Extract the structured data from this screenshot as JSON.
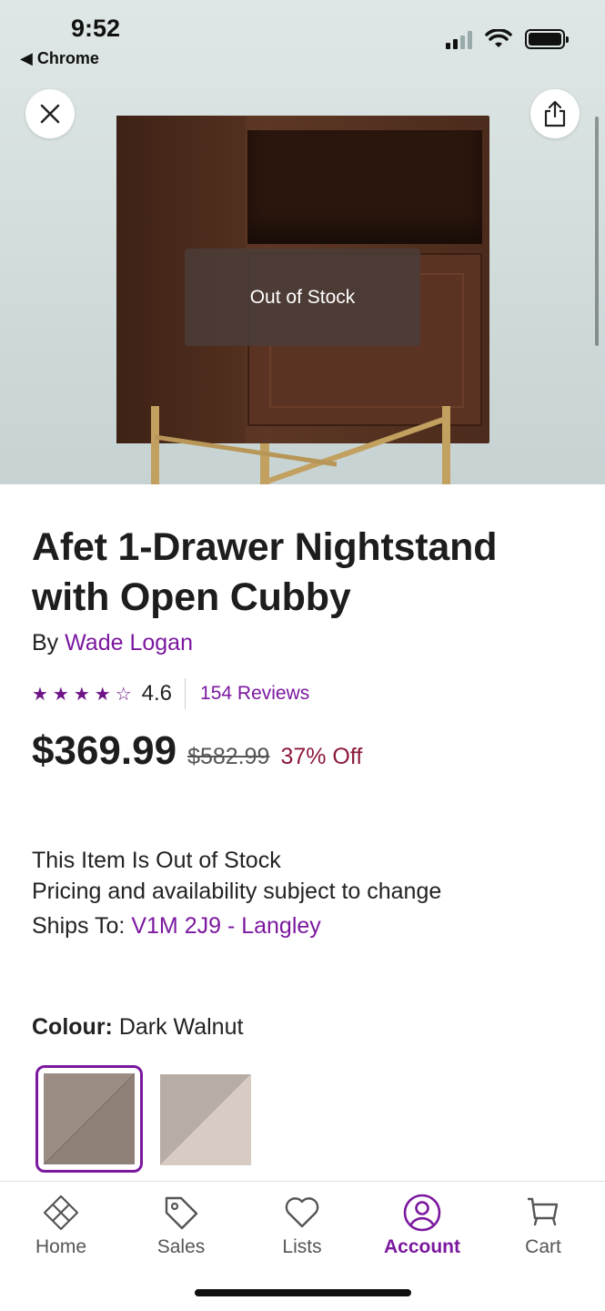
{
  "status_bar": {
    "time": "9:52",
    "back_app": "Chrome"
  },
  "hero": {
    "overlay_text": "Out of Stock"
  },
  "product": {
    "title": "Afet 1-Drawer Nightstand with Open Cubby",
    "by_prefix": "By",
    "brand": "Wade Logan",
    "rating": "4.6",
    "rating_value": 4.6,
    "stars": "★★★★☆",
    "reviews": "154 Reviews",
    "price": "$369.99",
    "original_price": "$582.99",
    "discount": "37% Off"
  },
  "availability": {
    "stock_line": "This Item Is Out of Stock",
    "pricing_note": "Pricing and availability subject to change",
    "ships_label": "Ships To:",
    "ships_value": "V1M 2J9 - Langley"
  },
  "colour": {
    "label": "Colour:",
    "value": "Dark Walnut",
    "swatches": [
      "Dark Walnut",
      "Light"
    ]
  },
  "tabs": [
    {
      "label": "Home",
      "icon": "home-icon"
    },
    {
      "label": "Sales",
      "icon": "tag-icon"
    },
    {
      "label": "Lists",
      "icon": "heart-icon"
    },
    {
      "label": "Account",
      "icon": "account-icon",
      "active": true
    },
    {
      "label": "Cart",
      "icon": "cart-icon"
    }
  ],
  "colors": {
    "accent": "#7b189f",
    "discount": "#8b1a3a"
  }
}
